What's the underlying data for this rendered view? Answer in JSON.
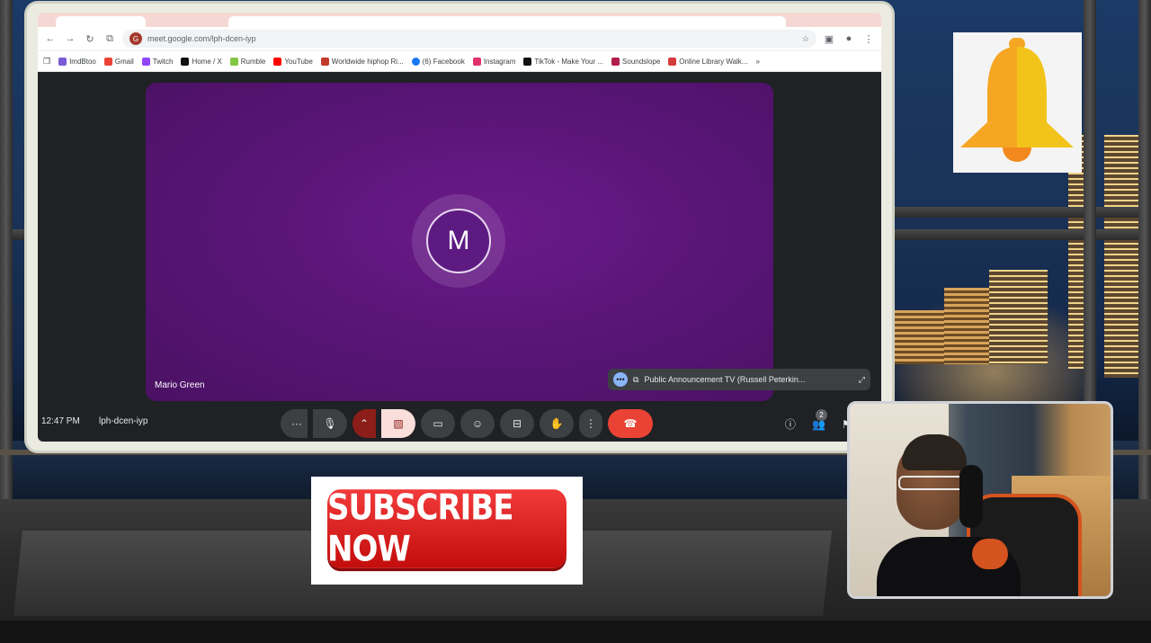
{
  "browser": {
    "url": "meet.google.com/lph-dcen-iyp",
    "site_badge": "G",
    "bookmarks": [
      {
        "label": "ImdBtoo",
        "color": "#7b5cd6"
      },
      {
        "label": "Gmail",
        "color": "#ea4335"
      },
      {
        "label": "Twitch",
        "color": "#9146ff"
      },
      {
        "label": "Home / X",
        "color": "#111111"
      },
      {
        "label": "Rumble",
        "color": "#85c742"
      },
      {
        "label": "YouTube",
        "color": "#ff0000"
      },
      {
        "label": "Worldwide hiphop Ri...",
        "color": "#c0392b"
      },
      {
        "label": "(6) Facebook",
        "color": "#1877f2"
      },
      {
        "label": "Instagram",
        "color": "#e1306c"
      },
      {
        "label": "TikTok - Make Your ...",
        "color": "#111111"
      },
      {
        "label": "Soundslope",
        "color": "#b11e4b"
      },
      {
        "label": "Online Library Walk...",
        "color": "#d63b3b"
      }
    ]
  },
  "meet": {
    "participant_initial": "M",
    "participant_name": "Mario Green",
    "presentation_label": "Public Announcement TV (Russell Peterkin...",
    "time": "12:47 PM",
    "meeting_code": "lph-dcen-iyp",
    "participants_count": "2"
  },
  "overlays": {
    "subscribe_text": "SUBSCRIBE NOW"
  },
  "colors": {
    "tile_purple": "#5a1578",
    "end_call_red": "#ea4335",
    "subscribe_red": "#d91515",
    "bell_orange": "#f5a623",
    "bell_yellow": "#f2c41b"
  }
}
